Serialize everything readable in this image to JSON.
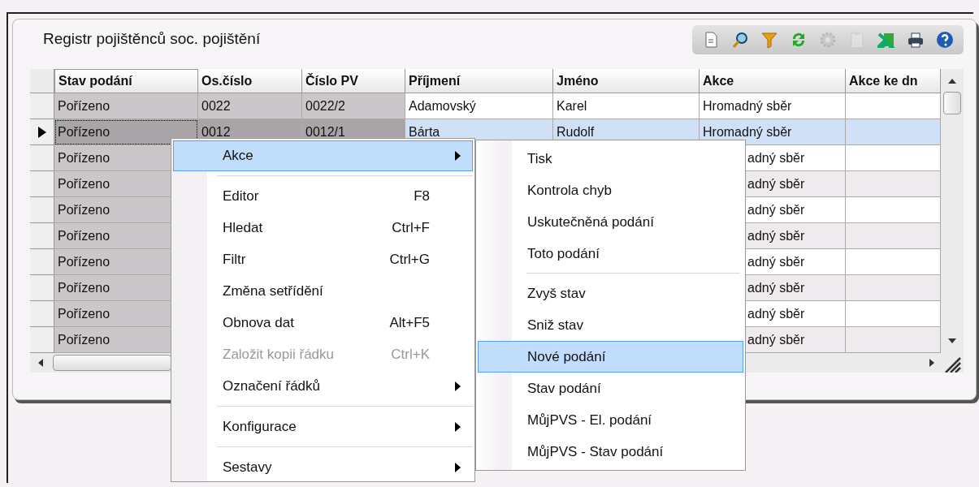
{
  "window": {
    "title": "Registr pojištěnců soc. pojištění"
  },
  "toolbar": [
    {
      "kind": "document",
      "disabled": false
    },
    {
      "kind": "search",
      "disabled": false
    },
    {
      "kind": "filter",
      "disabled": false
    },
    {
      "kind": "refresh",
      "disabled": false
    },
    {
      "kind": "settings",
      "disabled": true
    },
    {
      "kind": "clipboard",
      "disabled": true
    },
    {
      "kind": "excel",
      "disabled": false
    },
    {
      "kind": "print",
      "disabled": false
    },
    {
      "kind": "help",
      "disabled": false
    }
  ],
  "table": {
    "columns": [
      "Stav podání",
      "Os.číslo",
      "Číslo PV",
      "Příjmení",
      "Jméno",
      "Akce",
      "Akce ke dn"
    ],
    "rows": [
      {
        "selected": false,
        "stav_podani": "Pořízeno",
        "os_cislo": "0022",
        "cislo_pv": "0022/2",
        "prijmeni": "Adamovský",
        "jmeno": "Karel",
        "akce": "Hromadný sběr"
      },
      {
        "selected": true,
        "stav_podani": "Pořízeno",
        "os_cislo": "0012",
        "cislo_pv": "0012/1",
        "prijmeni": "Bárta",
        "jmeno": "Rudolf",
        "akce": "Hromadný sběr"
      },
      {
        "selected": false,
        "stav_podani": "Pořízeno",
        "akce": "adný sběr"
      },
      {
        "selected": false,
        "stav_podani": "Pořízeno",
        "akce": "adný sběr"
      },
      {
        "selected": false,
        "stav_podani": "Pořízeno",
        "akce": "adný sběr"
      },
      {
        "selected": false,
        "stav_podani": "Pořízeno",
        "akce": "adný sběr"
      },
      {
        "selected": false,
        "stav_podani": "Pořízeno",
        "akce": "adný sběr"
      },
      {
        "selected": false,
        "stav_podani": "Pořízeno",
        "akce": "adný sběr"
      },
      {
        "selected": false,
        "stav_podani": "Pořízeno",
        "akce": "adný sběr"
      },
      {
        "selected": false,
        "stav_podani": "Pořízeno",
        "akce": "adný sběr"
      }
    ]
  },
  "context_menu": {
    "items": [
      {
        "kind": "item",
        "label": "Akce",
        "submenu": true,
        "selected": true,
        "disabled": false
      },
      {
        "kind": "separator"
      },
      {
        "kind": "item",
        "label": "Editor",
        "shortcut": "F8",
        "submenu": false,
        "selected": false,
        "disabled": false
      },
      {
        "kind": "item",
        "label": "Hledat",
        "shortcut": "Ctrl+F",
        "submenu": false,
        "selected": false,
        "disabled": false
      },
      {
        "kind": "item",
        "label": "Filtr",
        "shortcut": "Ctrl+G",
        "submenu": false,
        "selected": false,
        "disabled": false
      },
      {
        "kind": "item",
        "label": "Změna setřídění",
        "submenu": false,
        "selected": false,
        "disabled": false
      },
      {
        "kind": "item",
        "label": "Obnova dat",
        "shortcut": "Alt+F5",
        "submenu": false,
        "selected": false,
        "disabled": false
      },
      {
        "kind": "item",
        "label": "Založit kopii řádku",
        "shortcut": "Ctrl+K",
        "submenu": false,
        "selected": false,
        "disabled": true
      },
      {
        "kind": "item",
        "label": "Označení řádků",
        "submenu": true,
        "selected": false,
        "disabled": false
      },
      {
        "kind": "separator"
      },
      {
        "kind": "item",
        "label": "Konfigurace",
        "submenu": true,
        "selected": false,
        "disabled": false
      },
      {
        "kind": "separator"
      },
      {
        "kind": "item",
        "label": "Sestavy",
        "submenu": true,
        "selected": false,
        "disabled": false
      }
    ]
  },
  "submenu": {
    "items": [
      {
        "kind": "item",
        "label": "Tisk",
        "selected": false
      },
      {
        "kind": "item",
        "label": "Kontrola chyb",
        "selected": false
      },
      {
        "kind": "item",
        "label": "Uskutečněná podání",
        "selected": false
      },
      {
        "kind": "item",
        "label": "Toto podání",
        "selected": false
      },
      {
        "kind": "separator"
      },
      {
        "kind": "item",
        "label": "Zvyš stav",
        "selected": false
      },
      {
        "kind": "item",
        "label": "Sniž stav",
        "selected": false
      },
      {
        "kind": "item",
        "label": "Nové podání",
        "selected": true
      },
      {
        "kind": "item",
        "label": "Stav podání",
        "selected": false
      },
      {
        "kind": "item",
        "label": "MůjPVS - El. podání",
        "selected": false
      },
      {
        "kind": "item",
        "label": "MůjPVS - Stav podání",
        "selected": false
      }
    ]
  }
}
